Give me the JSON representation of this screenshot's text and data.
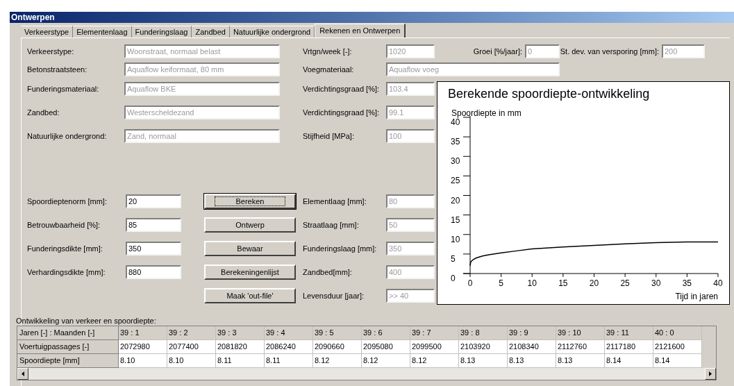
{
  "window": {
    "title": "Ontwerpen"
  },
  "tabs": [
    {
      "label": "Verkeerstype",
      "selected": false
    },
    {
      "label": "Elementenlaag",
      "selected": false
    },
    {
      "label": "Funderingslaag",
      "selected": false
    },
    {
      "label": "Zandbed",
      "selected": false
    },
    {
      "label": "Natuurlijke ondergrond",
      "selected": false
    },
    {
      "label": "Rekenen en Ontwerpen",
      "selected": true
    }
  ],
  "top_fields": {
    "verkeerstype": {
      "label": "Verkeerstype:",
      "value": "Woonstraat, normaal belast",
      "disabled": true
    },
    "vrtgn": {
      "label": "Vrtgn/week [-]:",
      "value": "1020",
      "disabled": true
    },
    "groei": {
      "label": "Groei [%/jaar]:",
      "value": "0",
      "disabled": true
    },
    "stdev": {
      "label": "St. dev. van versporing [mm]:",
      "value": "200",
      "disabled": true
    },
    "betonstraatsteen": {
      "label": "Betonstraatsteen:",
      "value": "Aquaflow keiformaat, 80 mm",
      "disabled": true
    },
    "voegmateriaal": {
      "label": "Voegmateriaal:",
      "value": "Aquaflow voeg",
      "disabled": true
    }
  },
  "material_rows": [
    {
      "label": "Funderingsmateriaal:",
      "value": "Aquaflow BKE",
      "disabled": true,
      "right_label": "Verdichtingsgraad [%]:",
      "right_value": "103.4",
      "right_disabled": true
    },
    {
      "label": "Zandbed:",
      "value": "Westerscheldezand",
      "disabled": true,
      "right_label": "Verdichtingsgraad [%]:",
      "right_value": "99.1",
      "right_disabled": true
    },
    {
      "label": "Natuurlijke ondergrond:",
      "value": "Zand, normaal",
      "disabled": true,
      "right_label": "Stijfheid [MPa]:",
      "right_value": "100",
      "right_disabled": true
    }
  ],
  "design_rows": [
    {
      "label": "Spoordieptenorm [mm]:",
      "value": "20",
      "disabled": false,
      "button": "Bereken",
      "focused": true,
      "right_label": "Elementlaag [mm]:",
      "right_value": "80",
      "right_disabled": true
    },
    {
      "label": "Betrouwbaarheid [%]:",
      "value": "85",
      "disabled": false,
      "button": "Ontwerp",
      "focused": false,
      "right_label": "Straatlaag [mm]:",
      "right_value": "50",
      "right_disabled": true
    },
    {
      "label": "Funderingsdikte [mm]:",
      "value": "350",
      "disabled": false,
      "button": "Bewaar",
      "focused": false,
      "right_label": "Funderingslaag [mm]:",
      "right_value": "350",
      "right_disabled": true
    },
    {
      "label": "Verhardingsdikte [mm]:",
      "value": "880",
      "disabled": false,
      "button": "Berekeningenlijst",
      "focused": false,
      "right_label": "Zandbed[mm]:",
      "right_value": "400",
      "right_disabled": true
    },
    {
      "button": "Maak 'out-file'",
      "focused": false,
      "right_label": "Levensduur [jaar]:",
      "right_value": ">> 40",
      "right_disabled": true
    }
  ],
  "chart_data": {
    "type": "line",
    "title": "Berekende spoordiepte-ontwikkeling",
    "ylabel": "Spoordiepte in mm",
    "xlabel": "Tijd in jaren",
    "x": [
      0,
      0.1,
      0.5,
      1,
      2,
      3,
      5,
      7.5,
      10,
      15,
      20,
      25,
      30,
      35,
      40
    ],
    "series": [
      {
        "color": "#000000",
        "values": [
          2,
          3,
          3.6,
          4,
          4.5,
          4.8,
          5.3,
          5.8,
          6.3,
          6.8,
          7.2,
          7.6,
          7.9,
          8.1,
          8.1
        ]
      }
    ],
    "xlim": [
      0,
      40
    ],
    "ylim": [
      0,
      40
    ],
    "xticks": [
      0,
      5,
      10,
      15,
      20,
      25,
      30,
      35,
      40
    ],
    "yticks": [
      0,
      5,
      10,
      15,
      20,
      25,
      30,
      35,
      40
    ]
  },
  "table": {
    "caption": "Ontwikkeling van verkeer en spoordiepte:",
    "rows": [
      {
        "kind": "header",
        "label": "Jaren [-] : Maanden [-]",
        "cells": [
          "39 : 1",
          "39 : 2",
          "39 : 3",
          "39 : 4",
          "39 : 5",
          "39 : 6",
          "39 : 7",
          "39 : 8",
          "39 : 9",
          "39 : 10",
          "39 : 11",
          "40 : 0"
        ]
      },
      {
        "kind": "data",
        "label": "Voertuigpassages [-]",
        "cells": [
          "2072980",
          "2077400",
          "2081820",
          "2086240",
          "2090660",
          "2095080",
          "2099500",
          "2103920",
          "2108340",
          "2112760",
          "2117180",
          "2121600"
        ]
      },
      {
        "kind": "data",
        "label": "Spoordiepte [mm]",
        "cells": [
          "8.10",
          "8.10",
          "8.11",
          "8.11",
          "8.12",
          "8.12",
          "8.12",
          "8.13",
          "8.13",
          "8.13",
          "8.14",
          "8.14"
        ]
      }
    ]
  }
}
